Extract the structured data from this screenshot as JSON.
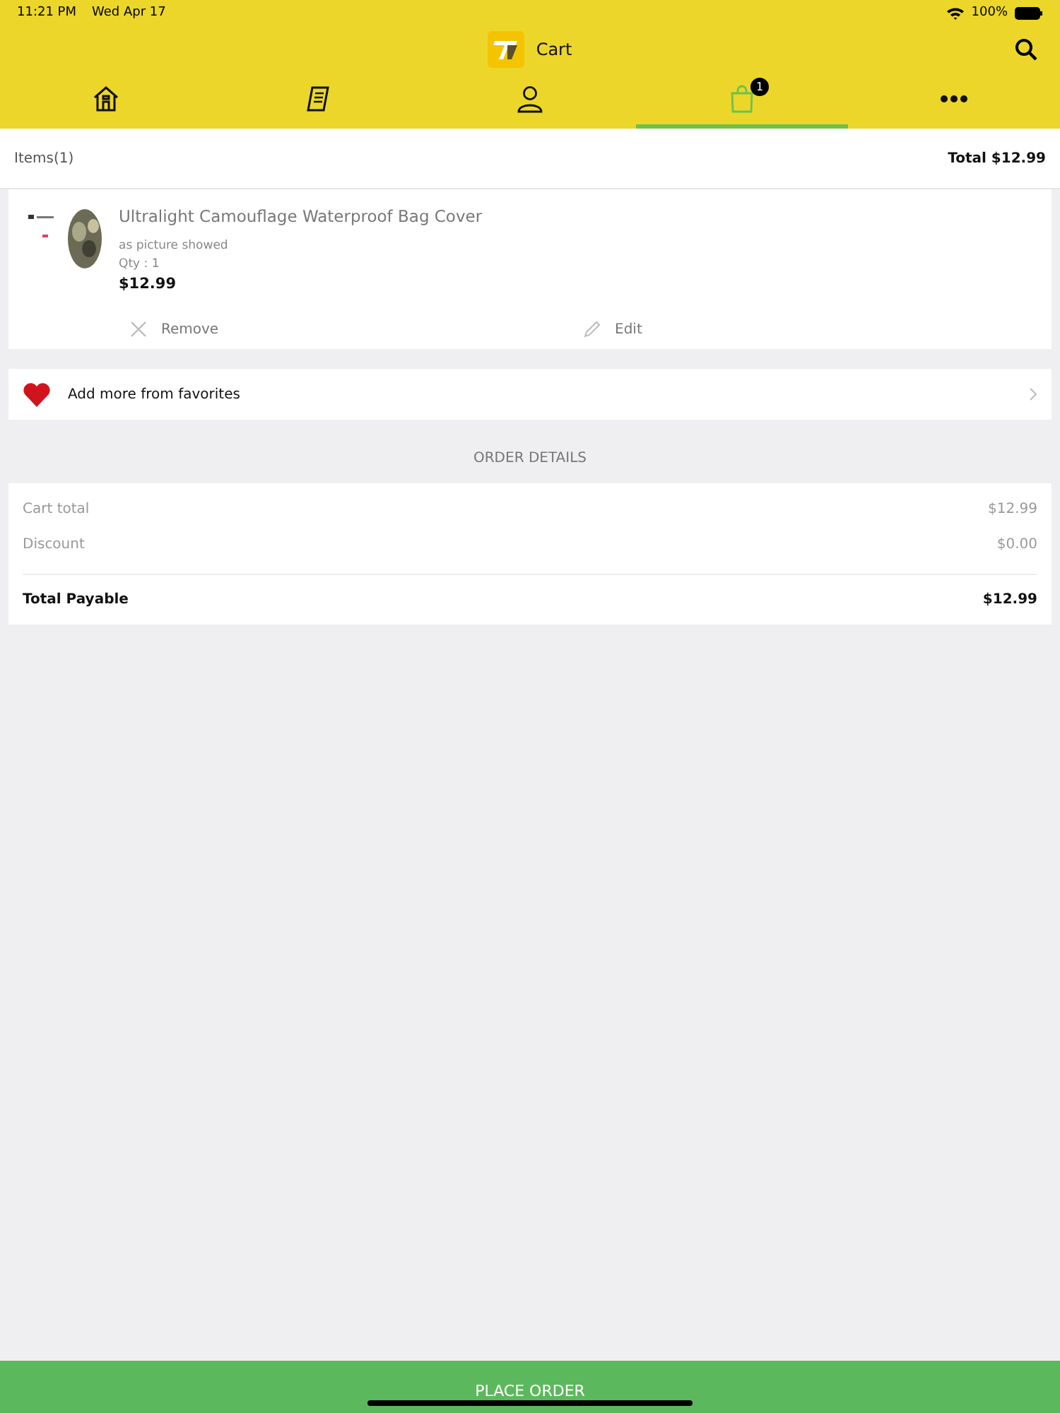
{
  "status_bar": {
    "time": "11:21 PM",
    "date": "Wed Apr 17",
    "battery": "100%"
  },
  "header": {
    "title": "Cart"
  },
  "tabs": [
    {
      "kind": "home",
      "selected": false
    },
    {
      "kind": "receipt",
      "selected": false
    },
    {
      "kind": "person",
      "selected": false
    },
    {
      "kind": "bag",
      "selected": true,
      "badge": "1"
    },
    {
      "kind": "more",
      "selected": false
    }
  ],
  "summary": {
    "items": "Items(1)",
    "total": "Total  $12.99"
  },
  "cart_items": [
    {
      "name": "Ultralight Camouflage Waterproof Bag Cover",
      "variant": "as picture showed",
      "qty": "Qty : 1",
      "price": "$12.99",
      "remove": "Remove",
      "edit": "Edit"
    }
  ],
  "favorites_link": "Add more from favorites",
  "order_details": {
    "heading": "ORDER DETAILS",
    "rows": [
      {
        "label": "Cart total",
        "value": "$12.99"
      },
      {
        "label": "Discount",
        "value": "$0.00"
      }
    ],
    "total_label": "Total Payable",
    "total_value": "$12.99"
  },
  "place_order": "PLACE ORDER"
}
